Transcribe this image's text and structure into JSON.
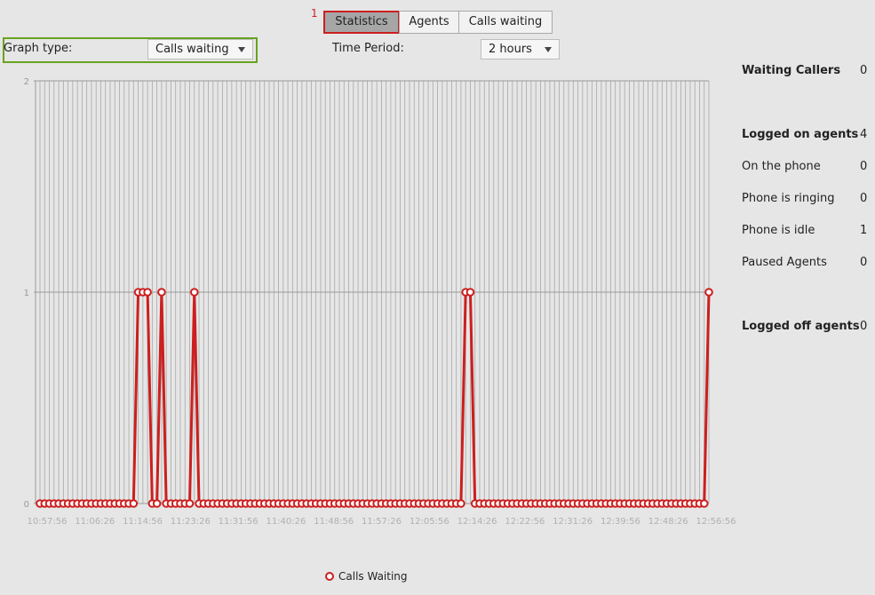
{
  "tabs": [
    {
      "label": "Statistics",
      "active": true
    },
    {
      "label": "Agents",
      "active": false
    },
    {
      "label": "Calls waiting",
      "active": false
    }
  ],
  "annotation_marker": "1",
  "graph_type": {
    "label": "Graph type:",
    "value": "Calls waiting"
  },
  "time_period": {
    "label": "Time Period:",
    "value": "2 hours"
  },
  "stats": [
    {
      "label": "Waiting Callers",
      "value": "0",
      "bold": true
    },
    {
      "label": "Logged on agents",
      "value": "4",
      "bold": true
    },
    {
      "label": "On the phone",
      "value": "0",
      "bold": false
    },
    {
      "label": "Phone is ringing",
      "value": "0",
      "bold": false
    },
    {
      "label": "Phone is idle",
      "value": "1",
      "bold": false
    },
    {
      "label": "Paused Agents",
      "value": "0",
      "bold": false
    },
    {
      "label": "Logged off agents",
      "value": "0",
      "bold": true
    }
  ],
  "colors": {
    "series": "#cc1f1f",
    "grid": "#a8a8a8",
    "highlight_tab": "#cc1f1f",
    "highlight_graphtype": "#6aa31f"
  },
  "chart_data": {
    "type": "line",
    "ylim": [
      0,
      2
    ],
    "yticks": [
      "0",
      "1",
      "2"
    ],
    "xtick_labels": [
      "10:57:56",
      "11:06:26",
      "11:14:56",
      "11:23:26",
      "11:31:56",
      "11:40:26",
      "11:48:56",
      "11:57:26",
      "12:05:56",
      "12:14:26",
      "12:22:56",
      "12:31:26",
      "12:39:56",
      "12:48:26",
      "12:56:56"
    ],
    "num_samples": 144,
    "spike_indices": [
      21,
      22,
      23,
      26,
      33,
      91,
      92,
      143
    ],
    "series": [
      {
        "name": "Calls Waiting",
        "spike_value": 1,
        "baseline_value": 0
      }
    ]
  }
}
